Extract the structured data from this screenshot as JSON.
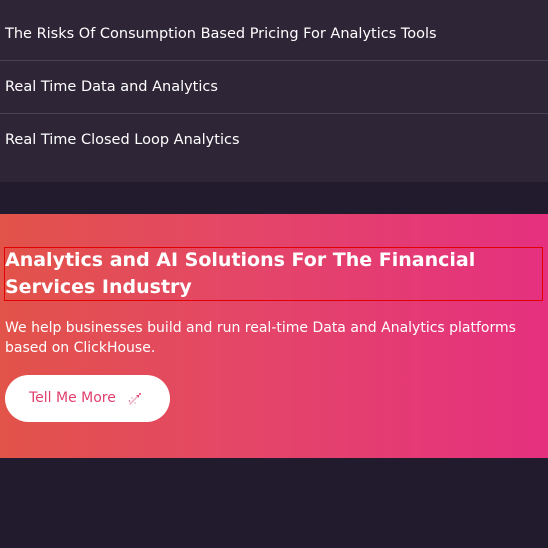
{
  "related_links": [
    {
      "label": "The Risks Of Consumption Based Pricing For Analytics Tools"
    },
    {
      "label": "Real Time Data and Analytics"
    },
    {
      "label": "Real Time Closed Loop Analytics"
    }
  ],
  "cta_section": {
    "heading": "Analytics and AI Solutions For The Financial Services Industry",
    "description": "We help businesses build and run real-time Data and Analytics platforms based on ClickHouse.",
    "button_label": "Tell Me More",
    "button_icon": "rocket-icon"
  },
  "colors": {
    "links_background": "#2e2537",
    "page_background": "#221b2e",
    "gradient_start": "#e25349",
    "gradient_end": "#e5307f",
    "button_text": "#e03f6c"
  }
}
